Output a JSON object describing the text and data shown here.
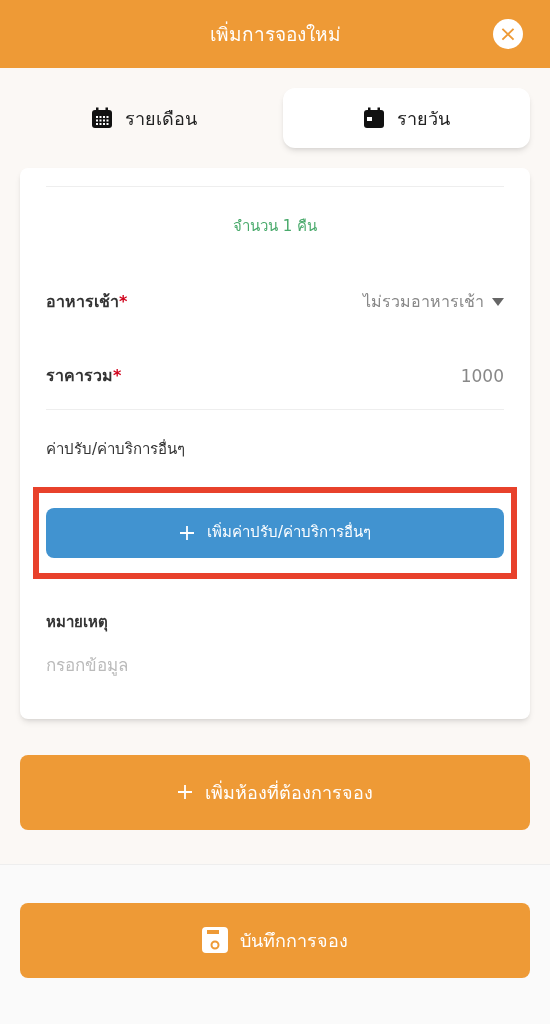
{
  "header": {
    "title": "เพิ่มการจองใหม่",
    "close": "×"
  },
  "tabs": [
    {
      "label": "รายเดือน",
      "kind": "month",
      "selected": false
    },
    {
      "label": "รายวัน",
      "kind": "day",
      "selected": true
    }
  ],
  "nights": "จำนวน 1 คืน",
  "fields": [
    {
      "label": "อาหารเช้า",
      "required_mark": "*",
      "kind": "select",
      "value": "ไม่รวมอาหารเช้า"
    },
    {
      "label": "ราคารวม",
      "required_mark": "*",
      "kind": "number",
      "value": "1000"
    }
  ],
  "fees": {
    "label": "ค่าปรับ/ค่าบริการอื่นๆ",
    "button": "เพิ่มค่าปรับ/ค่าบริการอื่นๆ",
    "highlighted": true
  },
  "note": {
    "label": "หมายเหตุ",
    "placeholder": "กรอกข้อมูล"
  },
  "add_room_button": "เพิ่มห้องที่ต้องการจอง",
  "save_button": "บันทึกการจอง"
}
